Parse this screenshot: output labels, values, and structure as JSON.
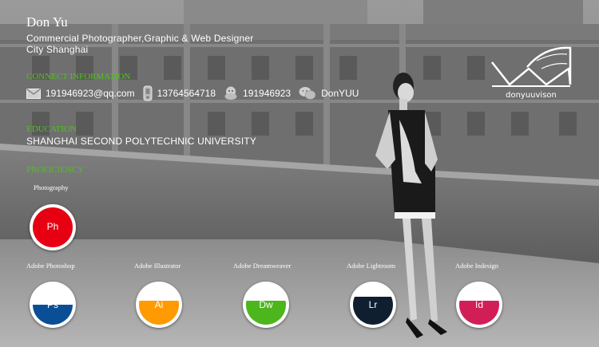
{
  "profile": {
    "name": "Don Yu",
    "title": "Commercial  Photographer,Graphic  &  Web  Designer",
    "city": "City  Shanghai"
  },
  "contact": {
    "heading": "CONNECT INFORMATION",
    "email": "191946923@qq.com",
    "phone": "13764564718",
    "qq": "191946923",
    "wechat": "DonYUU"
  },
  "education": {
    "heading": "EDUCATION",
    "school": "SHANGHAI  SECOND  POLYTECHNIC  UNIVERSITY"
  },
  "proficiency": {
    "heading": "PROFICIENCY",
    "photography_label": "Photography",
    "photography": {
      "abbr": "Ph",
      "color": "#e60012",
      "level": 1.0
    },
    "skills": [
      {
        "label": "Adobe Photoshop",
        "abbr": "Ps",
        "color": "#0a4f96",
        "level": 0.5
      },
      {
        "label": "Adobe Illustrator",
        "abbr": "Ai",
        "color": "#ff9a00",
        "level": 0.6
      },
      {
        "label": "Adobe Dreamweaver",
        "abbr": "Dw",
        "color": "#4cb61c",
        "level": 0.6
      },
      {
        "label": "Adobe Lightroom",
        "abbr": "Lr",
        "color": "#0f1f30",
        "level": 0.7
      },
      {
        "label": "Adobe Indesign",
        "abbr": "Id",
        "color": "#d21e56",
        "level": 0.6
      }
    ]
  },
  "logo_text": "donyuuvison"
}
